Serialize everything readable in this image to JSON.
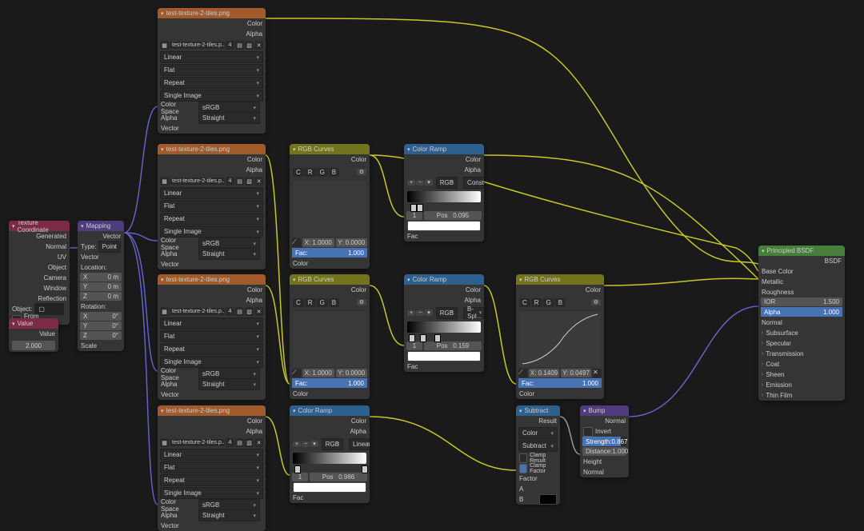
{
  "texcoord": {
    "title": "Texture Coordinate",
    "outputs": [
      "Generated",
      "Normal",
      "UV",
      "Object",
      "Camera",
      "Window",
      "Reflection"
    ],
    "object_label": "Object:",
    "from_instancer": "From Instancer"
  },
  "mapping": {
    "title": "Mapping",
    "out": "Vector",
    "type_label": "Type:",
    "type_value": "Point",
    "vector_in": "Vector",
    "location": {
      "label": "Location:",
      "x": "X",
      "xv": "0 m",
      "y": "Y",
      "yv": "0 m",
      "z": "Z",
      "zv": "0 m"
    },
    "rotation": {
      "label": "Rotation:",
      "x": "X",
      "xv": "0°",
      "y": "Y",
      "yv": "0°",
      "z": "Z",
      "zv": "0°"
    },
    "scale_in": "Scale"
  },
  "value": {
    "title": "Value",
    "out": "Value",
    "val": "2.000"
  },
  "imgtex": {
    "title": "test-texture-2-tiles.png",
    "out_color": "Color",
    "out_alpha": "Alpha",
    "filename": "test-texture-2-tiles.p...",
    "num": "4",
    "interp": "Linear",
    "proj": "Flat",
    "ext": "Repeat",
    "source": "Single Image",
    "cs_label": "Color Space",
    "cs": "sRGB",
    "alpha_label": "Alpha",
    "alpha": "Straight",
    "vector_in": "Vector"
  },
  "rgbcurves": {
    "title": "RGB Curves",
    "out_color": "Color",
    "channels": [
      "C",
      "R",
      "G",
      "B"
    ],
    "x_label": "X:",
    "x_val": "1.0000",
    "y_label": "Y:",
    "y_val": "0.0000",
    "fac_label": "Fac:",
    "fac_val": "1.000",
    "color_in": "Color"
  },
  "rgbcurves_big": {
    "title": "RGB Curves",
    "out_color": "Color",
    "channels": [
      "C",
      "R",
      "G",
      "B"
    ],
    "x_label": "X:",
    "x_val": "0.1409",
    "y_label": "Y:",
    "y_val": "0.0497",
    "fac_label": "Fac:",
    "fac_val": "1.000",
    "color_in": "Color"
  },
  "ramp1": {
    "title": "Color Ramp",
    "out_color": "Color",
    "out_alpha": "Alpha",
    "mode": "RGB",
    "interp": "Const...",
    "pos_label": "Pos",
    "pos": "0.095",
    "idx": "1",
    "fac_in": "Fac"
  },
  "ramp2": {
    "title": "Color Ramp",
    "out_color": "Color",
    "out_alpha": "Alpha",
    "mode": "RGB",
    "interp": "B-Spl...",
    "pos_label": "Pos",
    "pos": "0.159",
    "idx": "1",
    "fac_in": "Fac"
  },
  "ramp3": {
    "title": "Color Ramp",
    "out_color": "Color",
    "out_alpha": "Alpha",
    "mode": "RGB",
    "interp": "Linear",
    "pos_label": "Pos",
    "pos": "0.986",
    "idx": "1",
    "fac_in": "Fac"
  },
  "mix": {
    "title": "Subtract",
    "out": "Result",
    "mode": "Color",
    "blend": "Subtract",
    "clamp_result": "Clamp Result",
    "clamp_factor": "Clamp Factor",
    "factor_in": "Factor",
    "a_in": "A",
    "b_in": "B"
  },
  "bump": {
    "title": "Bump",
    "out": "Normal",
    "invert": "Invert",
    "strength_label": "Strength:",
    "strength": "0.867",
    "distance_label": "Distance:",
    "distance": "1.000",
    "height_in": "Height",
    "normal_in": "Normal"
  },
  "bsdf": {
    "title": "Principled BSDF",
    "out": "BSDF",
    "base_color": "Base Color",
    "metallic": "Metallic",
    "roughness": "Roughness",
    "ior_label": "IOR",
    "ior": "1.500",
    "alpha_label": "Alpha",
    "alpha": "1.000",
    "normal": "Normal",
    "groups": [
      "Subsurface",
      "Specular",
      "Transmission",
      "Coat",
      "Sheen",
      "Emission",
      "Thin Film"
    ]
  }
}
